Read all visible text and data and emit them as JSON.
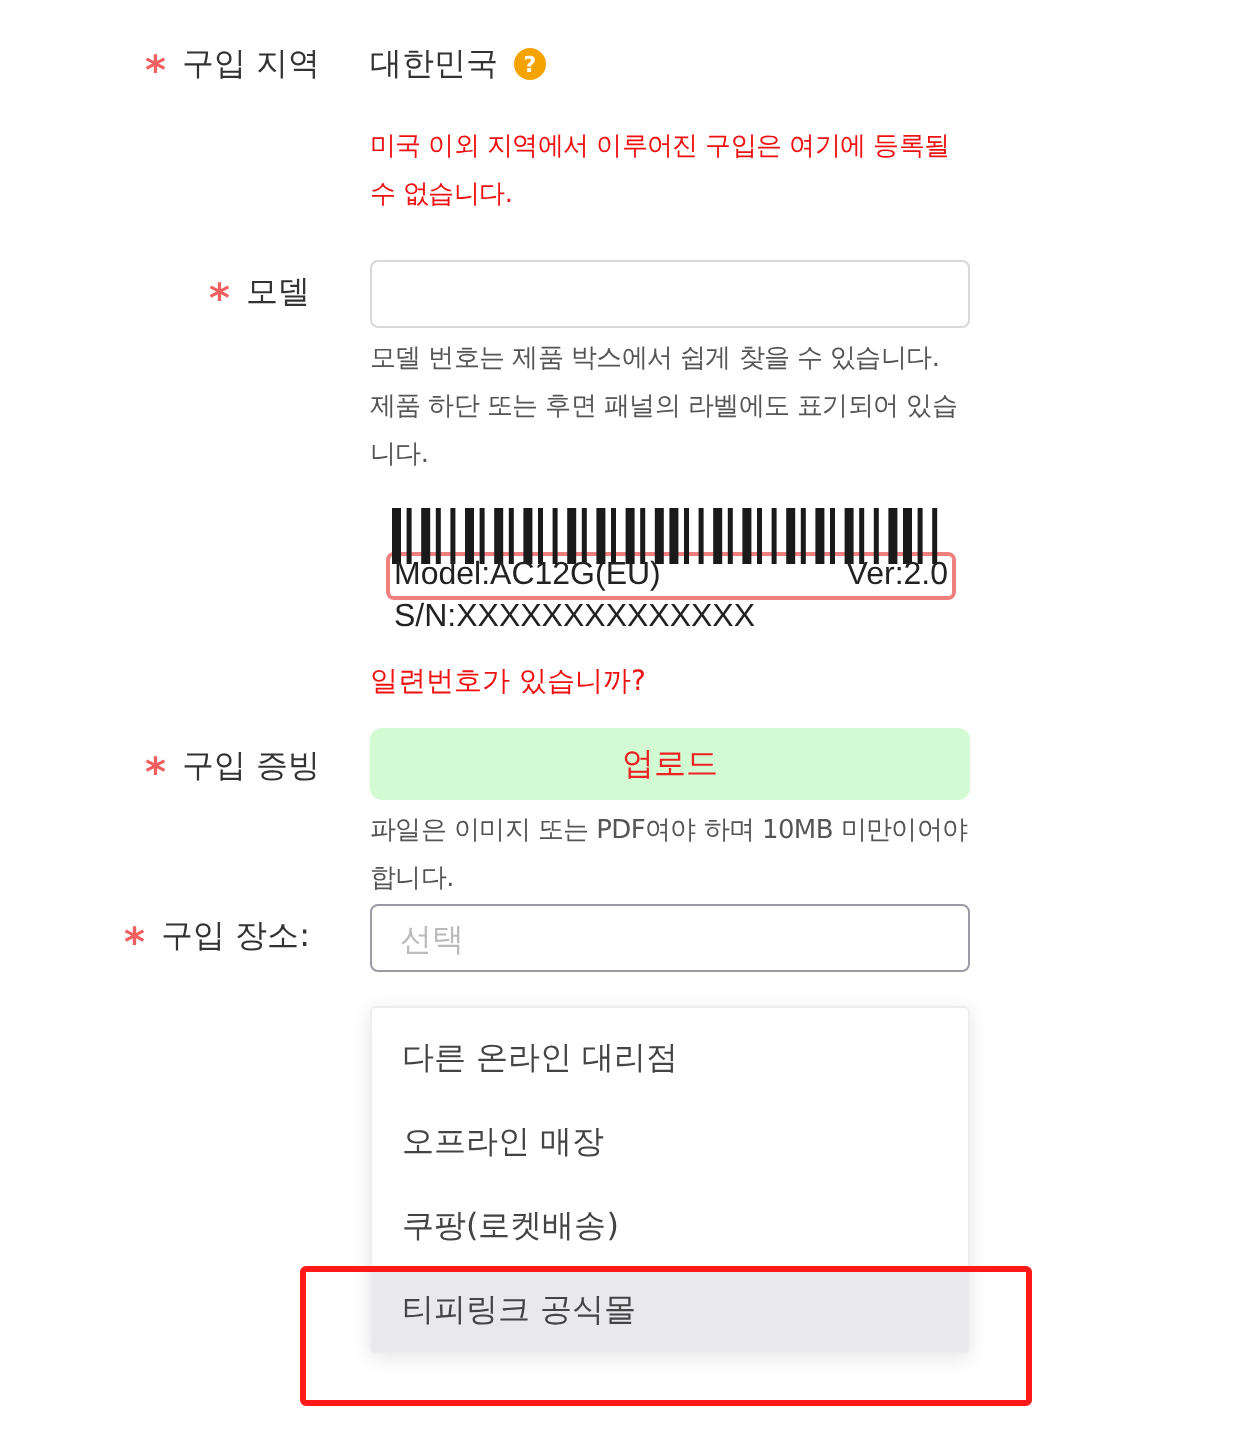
{
  "region": {
    "marker": "*",
    "label": "구입 지역",
    "value": "대한민국",
    "help_icon": "?",
    "warning": "미국 이외 지역에서 이루어진 구입은 여기에 등록될 수 없습니다."
  },
  "model": {
    "marker": "*",
    "label": "모델",
    "help": "모델 번호는 제품 박스에서 쉽게 찾을 수 있습니다. 제품 하단 또는 후면 패널의 라벨에도 표기되어 있습니다.",
    "label_model": "Model:AC12G(EU)",
    "label_version": "Ver:2.0",
    "label_serial": "S/N:XXXXXXXXXXXXXX",
    "serial_link": "일련번호가 있습니까?"
  },
  "proof": {
    "marker": "*",
    "label": "구입 증빙",
    "button": "업로드",
    "help": "파일은 이미지 또는 PDF여야 하며 10MB 미만이어야 합니다."
  },
  "place": {
    "marker": "*",
    "label": "구입 장소:",
    "placeholder": "선택",
    "options": [
      {
        "label": "다른 온라인 대리점",
        "selected": false
      },
      {
        "label": "오프라인 매장",
        "selected": false
      },
      {
        "label": "쿠팡(로켓배송)",
        "selected": false
      },
      {
        "label": "티피링크 공식몰",
        "selected": true
      }
    ]
  }
}
